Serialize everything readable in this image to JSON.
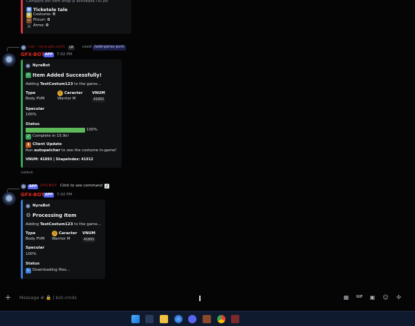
{
  "top_embed": {
    "line1": "Compară din item shop șl activează l-ul joc",
    "title": "Ticketele tale",
    "rows": [
      {
        "label": "Costume:",
        "value": "0"
      },
      {
        "label": "Frizuri:",
        "value": "0"
      },
      {
        "label": "Arme:",
        "value": "0"
      }
    ]
  },
  "msg1": {
    "reply_user": "ruis - nyra.gfx.anim",
    "reply_tag": "GM",
    "used": "used",
    "command": "add-perso-pvm",
    "author": "GFX-BOT",
    "app_badge": "APP",
    "time": "7:02 PM",
    "embed": {
      "author": "NyraBot",
      "title": "Item Added Successfully!",
      "adding_prefix": "Adding",
      "item": "TestCostum123",
      "adding_suffix": "to the game...",
      "type_label": "Type",
      "type_value": "Body PVM",
      "caracter_label": "Caracter",
      "caracter_value": "Warrior M",
      "vnum_label": "VNUM",
      "vnum_value": "41893",
      "specular_label": "Specular",
      "specular_value": "100%",
      "status_label": "Status",
      "progress_text": "100%",
      "progress": 1.0,
      "complete_text": "Complete in 15.9s!",
      "update_title": "Client Update",
      "update_run": "Run",
      "update_cmd": "autopatcher",
      "update_rest": "to see the costume in-game!",
      "footer": "VNUM: 41893 | ShapeIndex: 41912"
    },
    "edited": "(edited)"
  },
  "msg2": {
    "reply_app_badge": "APP",
    "reply_user": "GFX-BOT",
    "reply_text": "Click to see command",
    "author": "GFX-BOT",
    "app_badge": "APP",
    "time": "7:02 PM",
    "embed": {
      "author": "NyraBot",
      "title": "Processing Item",
      "adding_prefix": "Adding",
      "item": "TestCostum123",
      "adding_suffix": "to the game...",
      "type_label": "Type",
      "type_value": "Body PVM",
      "caracter_label": "Caracter",
      "caracter_value": "Warrior M",
      "vnum_label": "VNUM",
      "vnum_value": "41893",
      "specular_label": "Specular",
      "specular_value": "100%",
      "status_label": "Status",
      "status_value": "Downloading files..."
    }
  },
  "composer": {
    "placeholder": "Message # 🔒 | bot-cmds"
  },
  "colors": {
    "success_bar": "#3ba55c",
    "processing_bar": "#3b7dd8",
    "top_bar": "#d83c3e",
    "author_red": "#e0291f",
    "progress": "#5fb85a"
  }
}
